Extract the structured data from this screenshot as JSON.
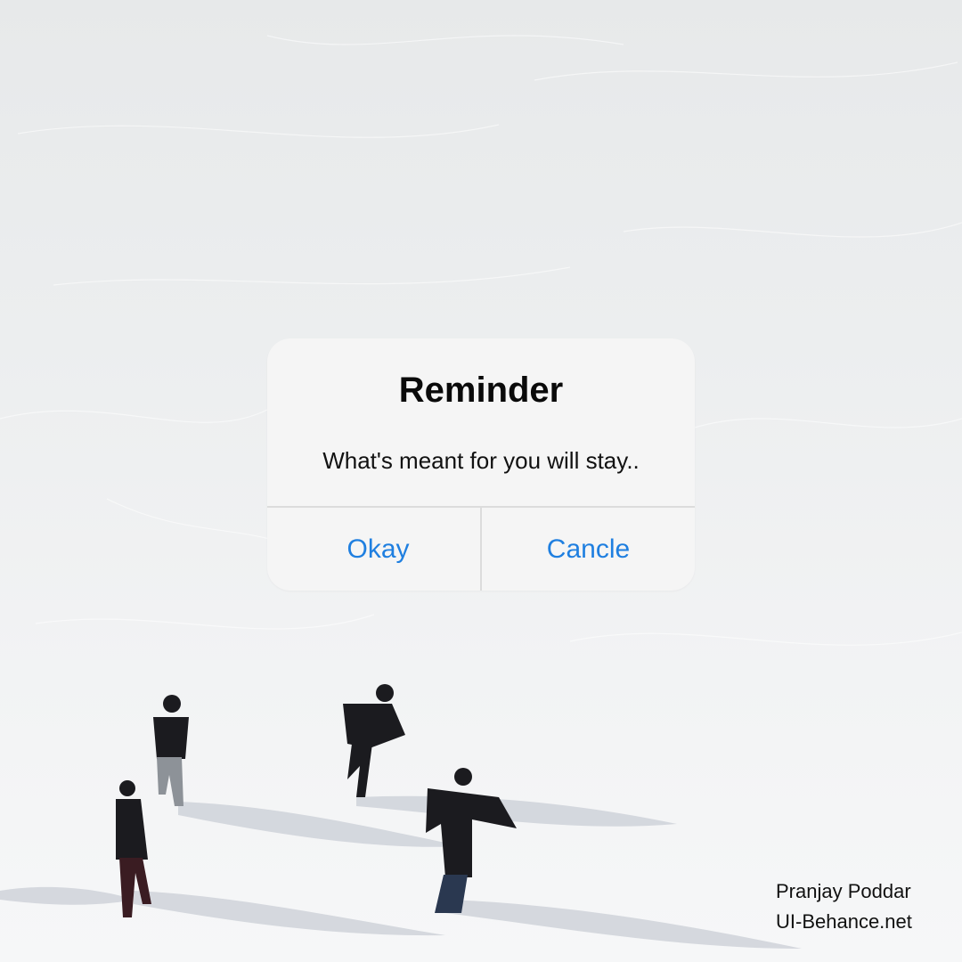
{
  "dialog": {
    "title": "Reminder",
    "message": "What's meant for you will stay..",
    "buttons": {
      "okay": "Okay",
      "cancel": "Cancle"
    }
  },
  "credit": {
    "author": "Pranjay Poddar",
    "site": "UI-Behance.net"
  },
  "colors": {
    "accent": "#1f7fe0",
    "dialog_bg": "#f5f5f5",
    "ice": "#eceeef"
  }
}
